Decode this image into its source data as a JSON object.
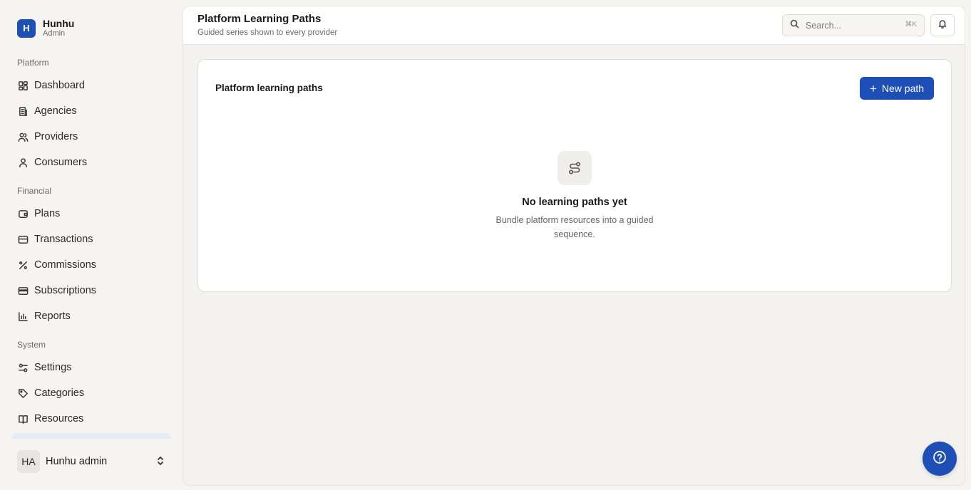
{
  "brand": {
    "logo_letter": "H",
    "name": "Hunhu",
    "role": "Admin"
  },
  "sidebar": {
    "sections": [
      {
        "label": "Platform",
        "items": [
          {
            "label": "Dashboard",
            "icon": "dashboard-icon"
          },
          {
            "label": "Agencies",
            "icon": "building-icon"
          },
          {
            "label": "Providers",
            "icon": "users-icon"
          },
          {
            "label": "Consumers",
            "icon": "user-icon"
          }
        ]
      },
      {
        "label": "Financial",
        "items": [
          {
            "label": "Plans",
            "icon": "wallet-icon"
          },
          {
            "label": "Transactions",
            "icon": "credit-card-icon"
          },
          {
            "label": "Commissions",
            "icon": "percent-icon"
          },
          {
            "label": "Subscriptions",
            "icon": "card-icon"
          },
          {
            "label": "Reports",
            "icon": "bar-chart-icon"
          }
        ]
      },
      {
        "label": "System",
        "items": [
          {
            "label": "Settings",
            "icon": "sliders-icon"
          },
          {
            "label": "Categories",
            "icon": "tag-icon"
          },
          {
            "label": "Resources",
            "icon": "book-icon"
          }
        ]
      }
    ]
  },
  "user": {
    "initials": "HA",
    "name": "Hunhu admin"
  },
  "header": {
    "title": "Platform Learning Paths",
    "subtitle": "Guided series shown to every provider",
    "search_placeholder": "Search...",
    "search_shortcut": "⌘K"
  },
  "card": {
    "title": "Platform learning paths",
    "new_button_label": "New path",
    "empty_title": "No learning paths yet",
    "empty_description": "Bundle platform resources into a guided sequence."
  },
  "colors": {
    "accent": "#1d4fb6",
    "background": "#f5f4f1"
  }
}
